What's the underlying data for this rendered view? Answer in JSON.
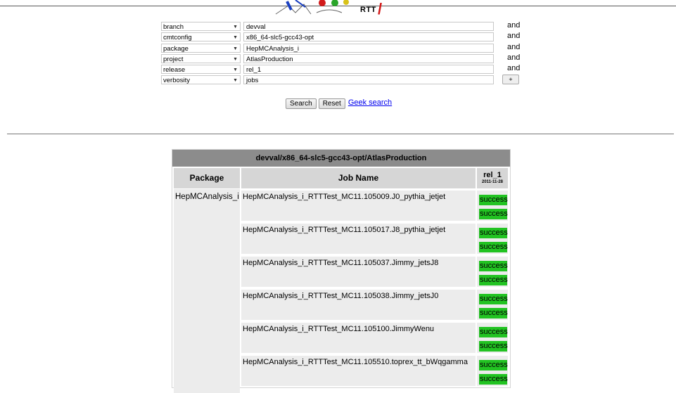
{
  "header": {
    "logo_text": "RTT",
    "logo_mark": "/"
  },
  "filters": [
    {
      "field": "branch",
      "value": "devval",
      "connector": "and"
    },
    {
      "field": "cmtconfig",
      "value": "x86_64-slc5-gcc43-opt",
      "connector": "and"
    },
    {
      "field": "package",
      "value": "HepMCAnalysis_i",
      "connector": "and"
    },
    {
      "field": "project",
      "value": "AtlasProduction",
      "connector": "and"
    },
    {
      "field": "release",
      "value": "rel_1",
      "connector": "and"
    },
    {
      "field": "verbosity",
      "value": "jobs",
      "connector": "+"
    }
  ],
  "actions": {
    "search_label": "Search",
    "reset_label": "Reset",
    "geek_label": "Geek search"
  },
  "results": {
    "title": "devval/x86_64-slc5-gcc43-opt/AtlasProduction",
    "columns": {
      "package": "Package",
      "job_name": "Job Name",
      "release": "rel_1",
      "release_date": "2011-11-28"
    },
    "package": "HepMCAnalysis_i",
    "jobs": [
      {
        "name": "HepMCAnalysis_i_RTTTest_MC11.105009.J0_pythia_jetjet",
        "status": [
          "success",
          "success"
        ]
      },
      {
        "name": "HepMCAnalysis_i_RTTTest_MC11.105017.J8_pythia_jetjet",
        "status": [
          "success",
          "success"
        ]
      },
      {
        "name": "HepMCAnalysis_i_RTTTest_MC11.105037.Jimmy_jetsJ8",
        "status": [
          "success",
          "success"
        ]
      },
      {
        "name": "HepMCAnalysis_i_RTTTest_MC11.105038.Jimmy_jetsJ0",
        "status": [
          "success",
          "success"
        ]
      },
      {
        "name": "HepMCAnalysis_i_RTTTest_MC11.105100.JimmyWenu",
        "status": [
          "success",
          "success"
        ]
      },
      {
        "name": "HepMCAnalysis_i_RTTTest_MC11.105510.toprex_tt_bWqgamma",
        "status": [
          "success",
          "success"
        ]
      }
    ]
  },
  "colors": {
    "success": "#22c322",
    "header_bg": "#8c8c8c",
    "cell_bg": "#ececec",
    "column_header_bg": "#d6d6d6",
    "link": "#0000ee"
  }
}
